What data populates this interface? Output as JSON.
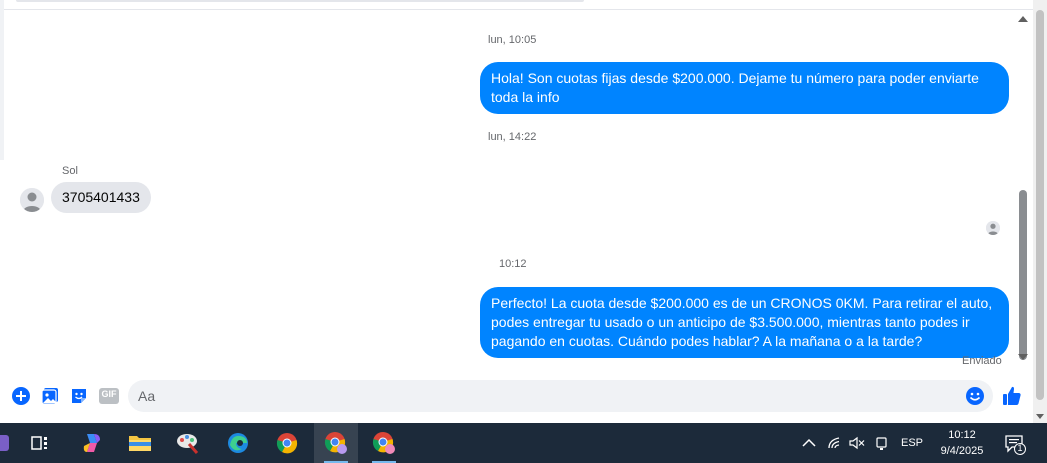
{
  "conversation": {
    "messages": [
      {
        "timestamp": "lun, 10:05"
      },
      {
        "direction": "out",
        "text": "Hola! Son cuotas fijas desde $200.000. Dejame tu número para poder enviarte toda la info"
      },
      {
        "timestamp": "lun, 14:22"
      },
      {
        "direction": "in",
        "sender": "Sol",
        "text": "3705401433"
      },
      {
        "timestamp": "10:12"
      },
      {
        "direction": "out",
        "text": "Perfecto! La cuota desde $200.000 es de un CRONOS 0KM. Para retirar el auto, podes entregar tu usado o un anticipo de $3.500.000, mientras tanto podes ir pagando en cuotas. Cuándo podes hablar? A la mañana o a la tarde?"
      }
    ],
    "delivery_status": "Enviado"
  },
  "composer": {
    "placeholder": "Aa",
    "value": "",
    "gif_label": "GIF",
    "icons": [
      "plus-circle-icon",
      "image-icon",
      "sticker-icon",
      "gif-icon",
      "emoji-icon",
      "thumbs-up-icon"
    ]
  },
  "taskbar": {
    "language": "ESP",
    "time": "10:12",
    "date": "9/4/2025",
    "notification_count": "1"
  },
  "colors": {
    "outgoing_bubble": "#0084ff",
    "incoming_bubble": "#e4e6eb",
    "accent": "#0866ff",
    "taskbar": "#1c2a3a"
  }
}
